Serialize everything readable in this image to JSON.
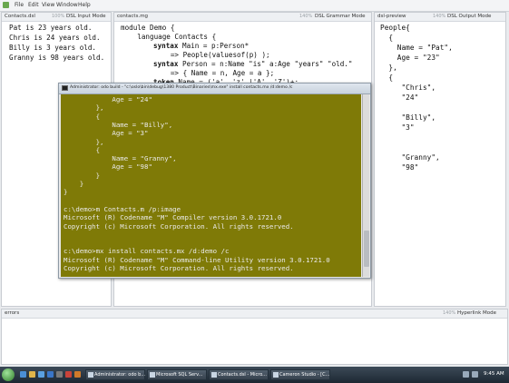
{
  "menu": [
    "File",
    "Edit",
    "View",
    "Window",
    "Help"
  ],
  "panes": {
    "input": {
      "title": "Contacts.dsl",
      "zoom": "100%",
      "mode": "DSL Input Mode",
      "lines": [
        "Pat is 23 years old.",
        "Chris is 24 years old.",
        "Billy is 3 years old.",
        "Granny is 98 years old."
      ]
    },
    "grammar": {
      "title": "contacts.mg",
      "zoom": "140%",
      "mode": "DSL Grammar Mode",
      "lines": [
        {
          "kw": "",
          "text": "module Demo {"
        },
        {
          "kw": "",
          "text": "    language Contacts {"
        },
        {
          "kw": "syntax",
          "text": " Main = p:Person*"
        },
        {
          "kw": "",
          "text": "            => People(valuesof(p) );"
        },
        {
          "kw": "syntax",
          "text": " Person = n:Name \"is\" a:Age \"years\" \"old.\""
        },
        {
          "kw": "",
          "text": "            => { Name = n, Age = a };"
        },
        {
          "kw": "token",
          "text": " Name = ('a'..'z' |'A'..'Z')+;"
        }
      ]
    },
    "output": {
      "title": "dsl-preview",
      "zoom": "140%",
      "mode": "DSL Output Mode",
      "lines": [
        "People{",
        "  {",
        "    Name = \"Pat\",",
        "    Age = \"23\"",
        "  },",
        "  {",
        "     \"Chris\",",
        "     \"24\"",
        "",
        "     \"Billy\",",
        "     \"3\"",
        "",
        "",
        "     \"Granny\",",
        "     \"98\""
      ]
    },
    "errors": {
      "title": "errors",
      "zoom": "140%",
      "mode": "Hyperlink Mode"
    }
  },
  "cmd": {
    "title": "Administrator: odo build - \"c:\\oslo\\bin\\debug\\1380 Product\\Binaries\\mx.exe\"  install contacts.mx /d:demo /c",
    "lines": [
      "            Age = \"24\"",
      "        },",
      "        {",
      "            Name = \"Billy\",",
      "            Age = \"3\"",
      "        },",
      "        {",
      "            Name = \"Granny\",",
      "            Age = \"98\"",
      "        }",
      "    }",
      "}",
      "",
      "c:\\demo>m Contacts.m /p:image",
      "Microsoft (R) Codename \"M\" Compiler version 3.0.1721.0",
      "Copyright (c) Microsoft Corporation. All rights reserved.",
      "",
      "",
      "c:\\demo>mx install contacts.mx /d:demo /c",
      "Microsoft (R) Codename \"M\" Command-line Utility version 3.0.1721.0",
      "Copyright (c) Microsoft Corporation. All rights reserved."
    ]
  },
  "taskbar": {
    "items": [
      "Administrator: odo b...",
      "Microsoft SQL Serv...",
      "Contacts.dsl - Micro...",
      "Cameron Studio - [C..."
    ],
    "clock": "9:45 AM"
  },
  "colors": {
    "cmd_bg": "#7f7a07",
    "cmd_text": "#eaeaea",
    "accent": "#2f7c2a"
  }
}
